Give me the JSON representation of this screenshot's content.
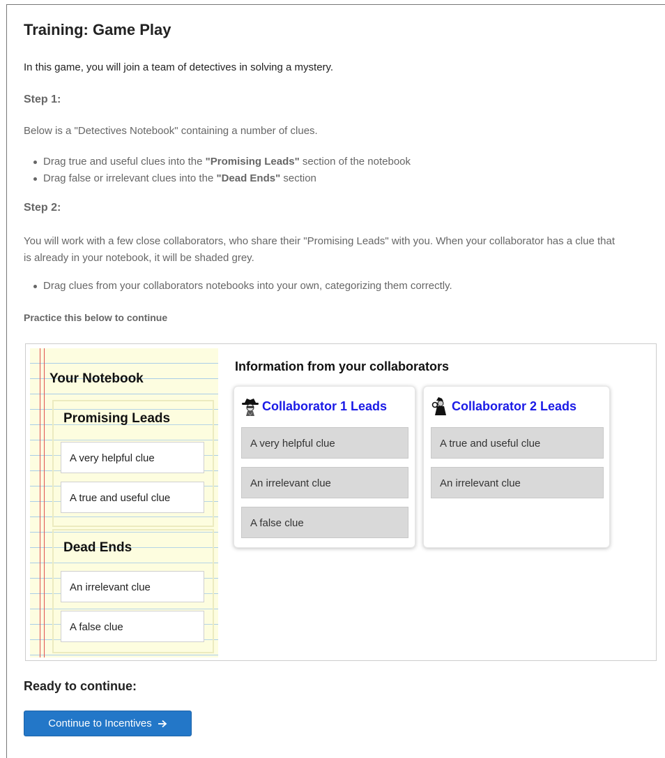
{
  "page": {
    "title": "Training: Game Play",
    "intro": "In this game, you will join a team of detectives in solving a mystery."
  },
  "step1": {
    "heading": "Step 1:",
    "text": "Below is a \"Detectives Notebook\" containing a number of clues.",
    "bullets": [
      {
        "prefix": "Drag true and useful clues into the ",
        "bold": "\"Promising Leads\"",
        "suffix": " section of the notebook"
      },
      {
        "prefix": "Drag false or irrelevant clues into the ",
        "bold": "\"Dead Ends\"",
        "suffix": " section"
      }
    ]
  },
  "step2": {
    "heading": "Step 2:",
    "text": "You will work with a few close collaborators, who share their \"Promising Leads\" with you. When your collaborator has a clue that is already in your notebook, it will be shaded grey.",
    "bullets": [
      "Drag clues from your collaborators notebooks into your own, categorizing them correctly."
    ]
  },
  "practice_label": "Practice this below to continue",
  "notebook": {
    "title": "Your Notebook",
    "promising": {
      "title": "Promising Leads",
      "clues": [
        "A very helpful clue",
        "A true and useful clue"
      ]
    },
    "dead_ends": {
      "title": "Dead Ends",
      "clues": [
        "An irrelevant clue",
        "A false clue"
      ]
    }
  },
  "collaborators": {
    "heading": "Information from your collaborators",
    "cards": [
      {
        "title": "Collaborator 1 Leads",
        "avatar_icon": "detective-hat-icon",
        "clues": [
          "A very helpful clue",
          "An irrelevant clue",
          "A false clue"
        ]
      },
      {
        "title": "Collaborator 2 Leads",
        "avatar_icon": "detective-magnifier-icon",
        "clues": [
          "A true and useful clue",
          "An irrelevant clue"
        ]
      }
    ]
  },
  "ready": {
    "label": "Ready to continue:",
    "button_label": "Continue to Incentives",
    "button_icon": "arrow-right-icon"
  },
  "colors": {
    "link_blue": "#1a1ae6",
    "button_blue": "#2377c8",
    "notebook_bg": "#fdfde0",
    "shaded_clue": "#d9d9d9"
  }
}
